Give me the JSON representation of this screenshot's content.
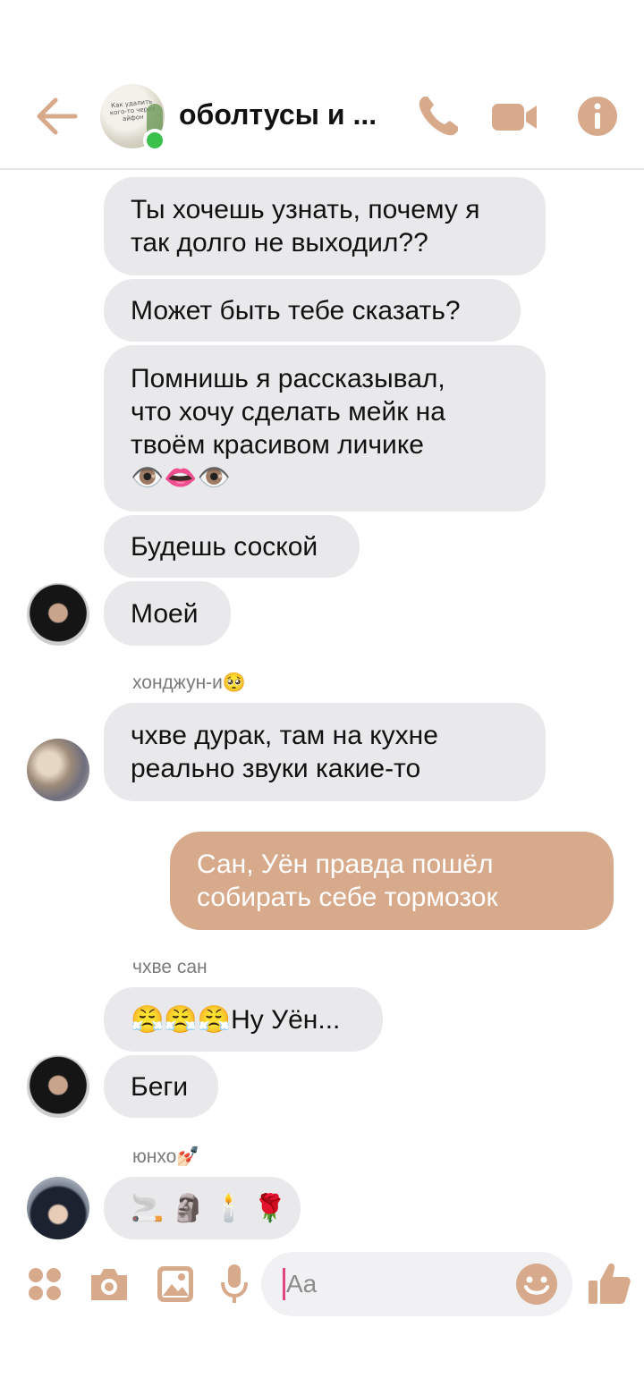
{
  "header": {
    "title": "оболтусы и ...",
    "group_avatar_text": "Как удалить кого-то через айфон",
    "accent": "#d8aa8c",
    "online_color": "#39c14b"
  },
  "chat": {
    "messages": [
      {
        "id": "m1",
        "lines": [
          "Ты хочешь узнать, почему я",
          "так долго не выходил??"
        ]
      },
      {
        "id": "m2",
        "lines": [
          "Может быть тебе сказать?"
        ]
      },
      {
        "id": "m3",
        "lines": [
          "Помнишь я рассказывал,",
          "что хочу сделать мейк на",
          "твоём красивом личике"
        ],
        "emoji": "👁️👄👁️"
      },
      {
        "id": "m4",
        "lines": [
          "Будешь соской"
        ]
      },
      {
        "id": "m5",
        "lines": [
          "Моей"
        ]
      },
      {
        "id": "s1",
        "sender": "хонджун-и",
        "sender_emoji": "🥺"
      },
      {
        "id": "m6",
        "lines": [
          "чхве дурак, там на кухне",
          "реально звуки какие-то"
        ]
      },
      {
        "id": "m7",
        "mine": true,
        "lines": [
          "Сан, Уён правда пошёл",
          "собирать себе тормозок"
        ]
      },
      {
        "id": "s2",
        "sender": "чхве сан"
      },
      {
        "id": "m8",
        "emoji_prefix": "😤😤😤",
        "lines": [
          "Ну Уён..."
        ]
      },
      {
        "id": "m9",
        "lines": [
          "Беги"
        ]
      },
      {
        "id": "s3",
        "sender": "юнхо",
        "sender_emoji": "💅🏻"
      },
      {
        "id": "m10",
        "emoji": "🚬 🗿 🕯️ 🌹"
      }
    ]
  },
  "composer": {
    "placeholder": "Aa",
    "icons": [
      "menu-dots-icon",
      "camera-icon",
      "gallery-icon",
      "microphone-icon",
      "emoji-icon",
      "thumbs-up-icon"
    ]
  }
}
